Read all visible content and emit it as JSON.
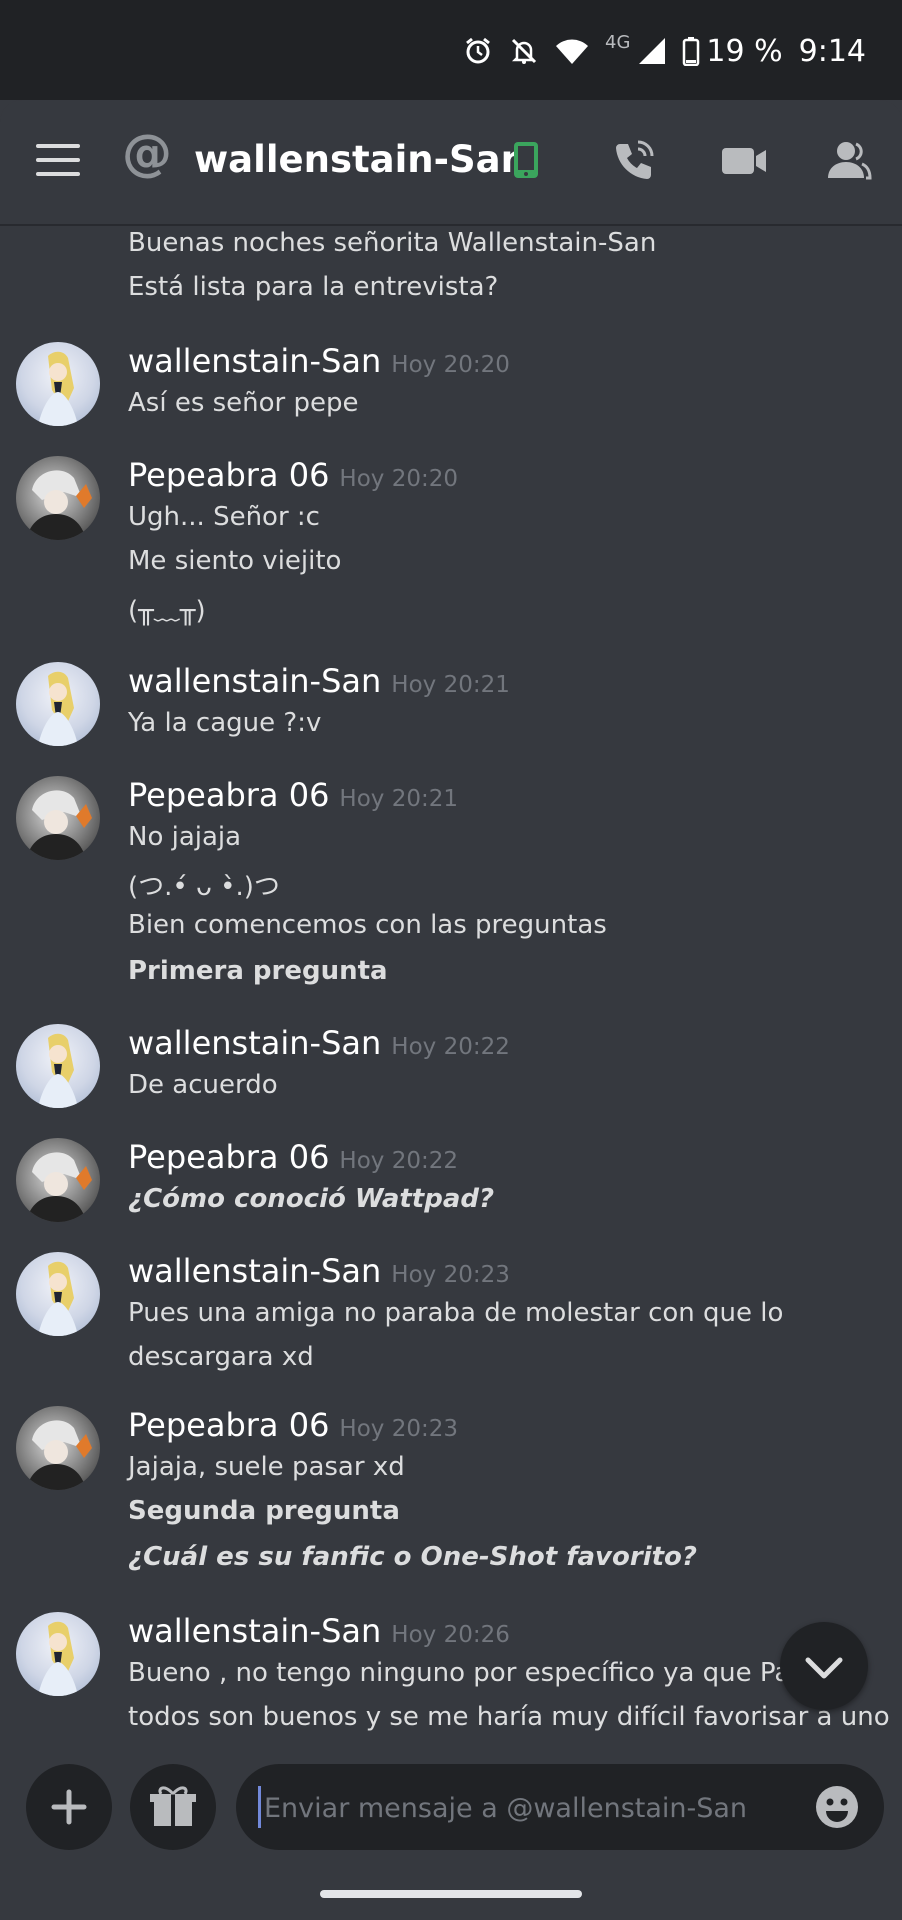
{
  "status_bar": {
    "network_type": "4G",
    "battery": "19 %",
    "time": "9:14"
  },
  "header": {
    "channel_prefix": "@",
    "title": "wallenstain-San"
  },
  "messages": [
    {
      "lines": [
        "Buenas noches señorita Wallenstain-San",
        "Está lista para la entrevista?"
      ]
    },
    {
      "author": "wallenstain-San",
      "time": "Hoy 20:20",
      "lines": [
        "Así es señor pepe"
      ]
    },
    {
      "author": "Pepeabra 06",
      "time": "Hoy 20:20",
      "lines": [
        "Ugh... Señor :c",
        "Me siento viejito",
        "(╥﹏╥)"
      ]
    },
    {
      "author": "wallenstain-San",
      "time": "Hoy 20:21",
      "lines": [
        "Ya la  cague ?:v"
      ]
    },
    {
      "author": "Pepeabra 06",
      "time": "Hoy 20:21",
      "lines": [
        "No jajaja",
        "(つ.•́ ᴗ •̀.)つ",
        "Bien comencemos con las preguntas",
        "Primera pregunta"
      ]
    },
    {
      "author": "wallenstain-San",
      "time": "Hoy 20:22",
      "lines": [
        "De acuerdo"
      ]
    },
    {
      "author": "Pepeabra 06",
      "time": "Hoy 20:22",
      "lines": [
        "¿Cómo conoció Wattpad?"
      ]
    },
    {
      "author": "wallenstain-San",
      "time": "Hoy 20:23",
      "lines": [
        "Pues una amiga no paraba de molestar con que lo",
        "descargara xd"
      ]
    },
    {
      "author": "Pepeabra 06",
      "time": "Hoy 20:23",
      "lines": [
        "Jajaja, suele pasar xd",
        "Segunda pregunta",
        "¿Cuál es su fanfic o One-Shot favorito?"
      ]
    },
    {
      "author": "wallenstain-San",
      "time": "Hoy 20:26",
      "lines": [
        "Bueno ,  no tengo ninguno por específico ya que Para",
        "todos son buenos y se me haría muy difícil favorisar a uno"
      ]
    }
  ],
  "composer": {
    "placeholder": "Enviar mensaje a @wallenstain-San"
  },
  "icons": {
    "menu": "hamburger-icon",
    "mobile": "mobile-phone-icon",
    "call": "phone-call-icon",
    "video": "video-camera-icon",
    "members": "members-icon",
    "add": "plus-icon",
    "gift": "gift-icon",
    "emoji": "emoji-icon",
    "scroll": "chevron-down-icon"
  },
  "colors": {
    "background": "#36393f",
    "status_bar": "#202225",
    "online_mobile": "#3ba55d",
    "accent": "#7289da"
  }
}
